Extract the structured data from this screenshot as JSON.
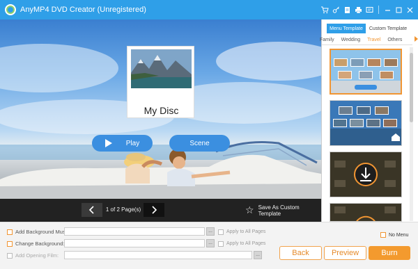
{
  "titlebar": {
    "title": "AnyMP4 DVD Creator (Unregistered)",
    "icons": [
      "cart-icon",
      "key-icon",
      "doc-icon",
      "print-icon",
      "feedback-icon",
      "minimize-icon",
      "maximize-icon",
      "close-icon"
    ]
  },
  "preview": {
    "disc_title": "My Disc",
    "play_label": "Play",
    "scene_label": "Scene"
  },
  "navbar": {
    "page_info": "1 of 2 Page(s)",
    "save_template_label": "Save As Custom Template"
  },
  "template_panel": {
    "tabs": [
      {
        "label": "Menu Template",
        "active": true
      },
      {
        "label": "Custom Template",
        "active": false
      }
    ],
    "categories": [
      "Family",
      "Wedding",
      "Travel",
      "Others"
    ],
    "active_category": "Travel",
    "thumbnails": 4,
    "selected_thumbnail": 1
  },
  "options": {
    "background_music_label": "Add Background Music:",
    "change_background_label": "Change Background:",
    "opening_film_label": "Add Opening Film:",
    "browse_label": "...",
    "apply_all_label": "Apply to All Pages",
    "no_menu_label": "No Menu"
  },
  "buttons": {
    "back": "Back",
    "preview": "Preview",
    "burn": "Burn"
  },
  "colors": {
    "accent_blue": "#2f9fe8",
    "accent_orange": "#f39a2e"
  }
}
